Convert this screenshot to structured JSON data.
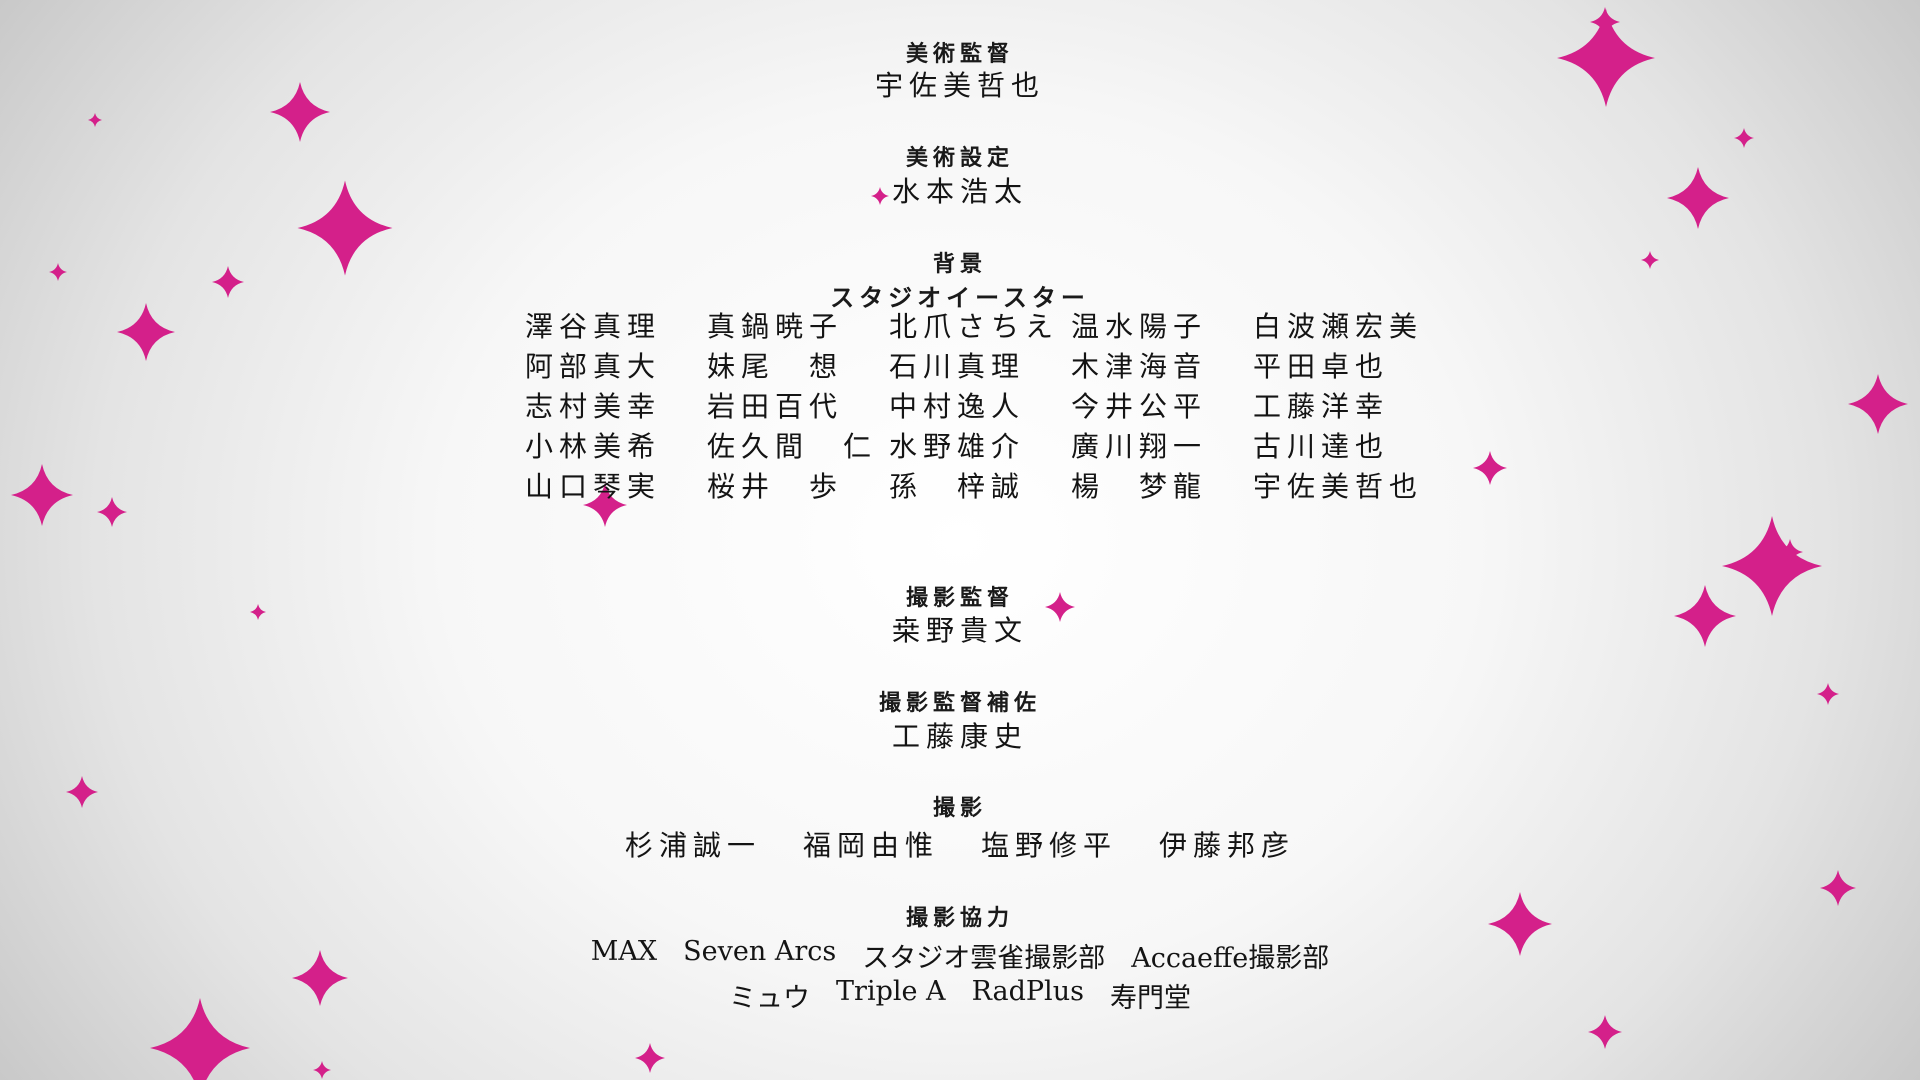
{
  "theme": {
    "sparkle_color": "#d4208a",
    "text_color": "#141414"
  },
  "credits": {
    "art_director": {
      "role": "美術監督",
      "name": "宇佐美哲也"
    },
    "art_setting": {
      "role": "美術設定",
      "name": "水本浩太"
    },
    "background": {
      "role": "背景",
      "studio": "スタジオイースター",
      "staff": [
        [
          "澤谷真理",
          "真鍋暁子",
          "北爪さちえ",
          "温水陽子",
          "白波瀬宏美"
        ],
        [
          "阿部真大",
          "妹尾　想",
          "石川真理",
          "木津海音",
          "平田卓也"
        ],
        [
          "志村美幸",
          "岩田百代",
          "中村逸人",
          "今井公平",
          "工藤洋幸"
        ],
        [
          "小林美希",
          "佐久間　仁",
          "水野雄介",
          "廣川翔一",
          "古川達也"
        ],
        [
          "山口琴実",
          "桜井　歩",
          "孫　梓誠",
          "楊　梦龍",
          "宇佐美哲也"
        ]
      ]
    },
    "photography_director": {
      "role": "撮影監督",
      "name": "桒野貴文"
    },
    "photography_director_assistant": {
      "role": "撮影監督補佐",
      "name": "工藤康史"
    },
    "photography": {
      "role": "撮影",
      "names": [
        "杉浦誠一",
        "福岡由惟",
        "塩野修平",
        "伊藤邦彦"
      ]
    },
    "photography_cooperation": {
      "role": "撮影協力",
      "line1": [
        "MAX",
        "Seven Arcs",
        "スタジオ雲雀撮影部",
        "Accaeffe撮影部"
      ],
      "line2": [
        "ミュウ",
        "Triple A",
        "RadPlus",
        "寿門堂"
      ]
    }
  }
}
